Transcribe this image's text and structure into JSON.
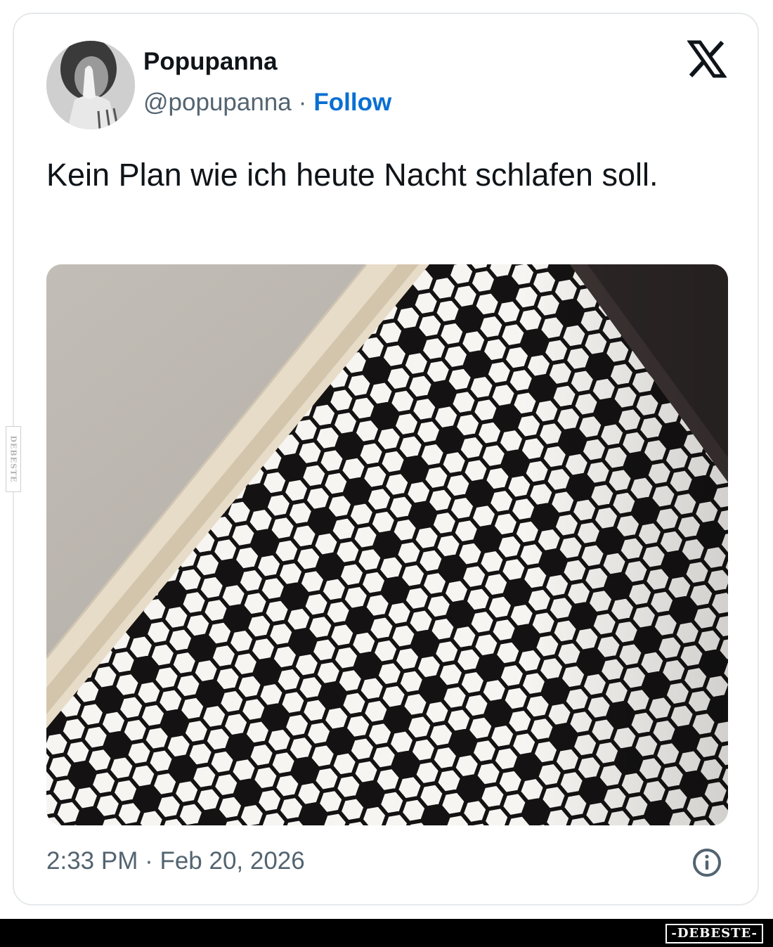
{
  "tweet": {
    "display_name": "Popupanna",
    "handle": "@popupanna",
    "separator": "·",
    "follow_label": "Follow",
    "text": "Kein Plan wie ich heute Nacht schlafen soll.",
    "timestamp": "2:33 PM · Feb 20, 2026"
  },
  "icons": {
    "brand": "x-logo-icon",
    "info": "info-icon"
  },
  "watermark": {
    "side": "DEBESTE",
    "brand": "-DEBESTE-"
  },
  "colors": {
    "text": "#0f1419",
    "secondary": "#536471",
    "follow": "#0a6fd1",
    "border": "#e6e9ec"
  }
}
